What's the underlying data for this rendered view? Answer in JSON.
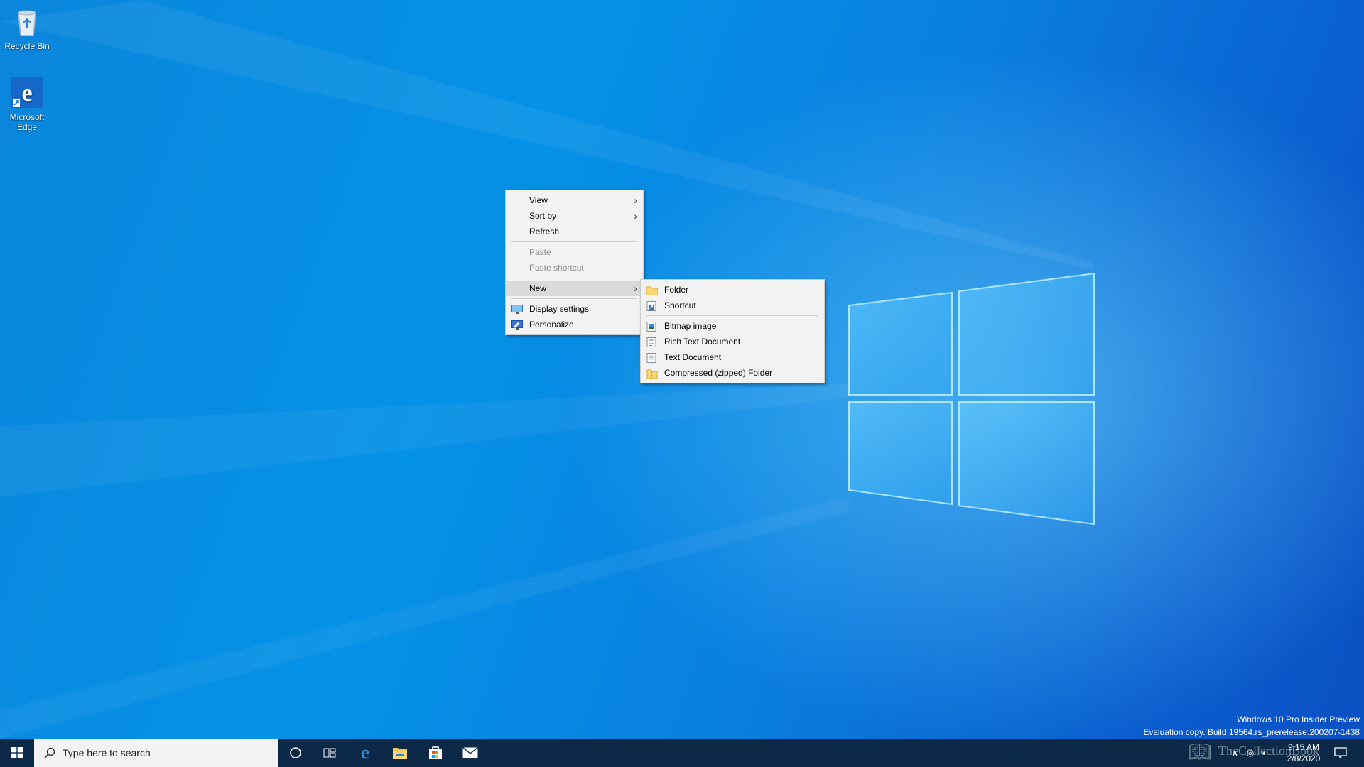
{
  "desktop": {
    "icons": [
      {
        "label": "Recycle Bin",
        "icon": "recycle-bin-icon"
      },
      {
        "label": "Microsoft Edge",
        "icon": "edge-icon"
      }
    ]
  },
  "context_menu": {
    "items": [
      {
        "label": "View",
        "has_submenu": true
      },
      {
        "label": "Sort by",
        "has_submenu": true
      },
      {
        "label": "Refresh"
      },
      {
        "label": "Paste",
        "disabled": true
      },
      {
        "label": "Paste shortcut",
        "disabled": true
      },
      {
        "label": "New",
        "has_submenu": true,
        "highlighted": true
      },
      {
        "label": "Display settings",
        "icon": "display-settings-icon"
      },
      {
        "label": "Personalize",
        "icon": "personalize-icon"
      }
    ]
  },
  "new_submenu": {
    "items": [
      {
        "label": "Folder",
        "icon": "folder-icon"
      },
      {
        "label": "Shortcut",
        "icon": "shortcut-icon"
      },
      {
        "label": "Bitmap image",
        "icon": "bitmap-icon"
      },
      {
        "label": "Rich Text Document",
        "icon": "rich-text-icon"
      },
      {
        "label": "Text Document",
        "icon": "text-document-icon"
      },
      {
        "label": "Compressed (zipped) Folder",
        "icon": "zip-folder-icon"
      }
    ]
  },
  "taskbar": {
    "search_placeholder": "Type here to search",
    "pinned": [
      "cortana-icon",
      "task-view-icon",
      "edge-icon",
      "file-explorer-icon",
      "store-icon",
      "mail-icon"
    ],
    "clock_time": "9:15 AM",
    "clock_date": "2/8/2020"
  },
  "watermark": {
    "line1": "Windows 10 Pro Insider Preview",
    "line2": "Evaluation copy. Build 19564.rs_prerelease.200207-1438",
    "overlay": "TheCollectionBook"
  },
  "colors": {
    "desktop_blue": "#0a86dc",
    "taskbar": "#0c2a48",
    "menu_bg": "#f2f2f2",
    "menu_highlight": "#dadada"
  }
}
